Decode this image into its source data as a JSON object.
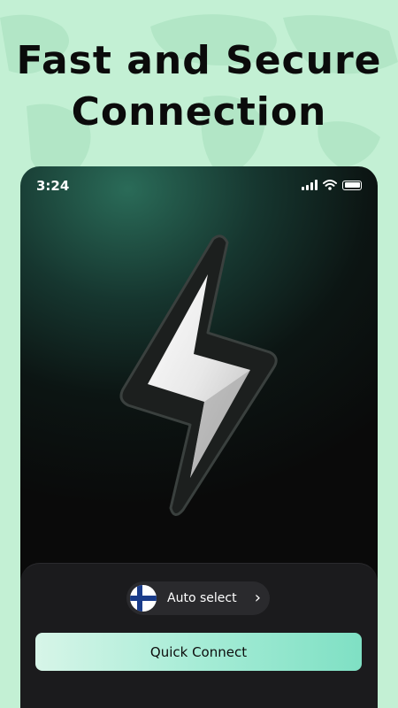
{
  "headline": {
    "line1": "Fast and Secure",
    "line2": "Connection"
  },
  "status_bar": {
    "time": "3:24"
  },
  "server_selector": {
    "flag": "finland-flag",
    "label": "Auto select",
    "chevron": "›"
  },
  "connect_button": {
    "label": "Quick Connect"
  },
  "colors": {
    "background": "#c3f0d4",
    "phone_bg": "#0a0a0a",
    "accent_gradient_start": "#d7f5e8",
    "accent_gradient_end": "#7fe0c4",
    "sheet_bg": "#1b1b1d"
  },
  "icons": {
    "bolt": "lightning-bolt-icon",
    "signal": "signal-icon",
    "wifi": "wifi-icon",
    "battery": "battery-icon"
  }
}
